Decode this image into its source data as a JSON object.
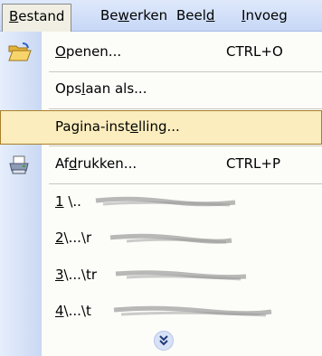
{
  "menubar": {
    "items": [
      {
        "pre": "",
        "u": "B",
        "post": "estand",
        "active": true
      },
      {
        "pre": "Be",
        "u": "w",
        "post": "erken",
        "active": false
      },
      {
        "pre": "Beel",
        "u": "d",
        "post": "",
        "active": false
      },
      {
        "pre": "",
        "u": "I",
        "post": "nvoeg",
        "active": false
      }
    ]
  },
  "menu": {
    "open": {
      "pre": "",
      "u": "O",
      "post": "penen...",
      "shortcut": "CTRL+O",
      "icon": "folder-open-icon"
    },
    "save_as": {
      "pre": "Ops",
      "u": "l",
      "post": "aan als..."
    },
    "page_setup": {
      "pre": "Pagina-inst",
      "u": "e",
      "post": "lling..."
    },
    "print": {
      "pre": "Af",
      "u": "d",
      "post": "rukken...",
      "shortcut": "CTRL+P",
      "icon": "printer-icon"
    },
    "recent": [
      {
        "num": "1",
        "path": "\\.."
      },
      {
        "num": "2",
        "path": "\\...\\r"
      },
      {
        "num": "3",
        "path": "\\...\\tr"
      },
      {
        "num": "4",
        "path": "\\...\\t"
      }
    ],
    "more_icon": "chevron-double-down-icon"
  }
}
